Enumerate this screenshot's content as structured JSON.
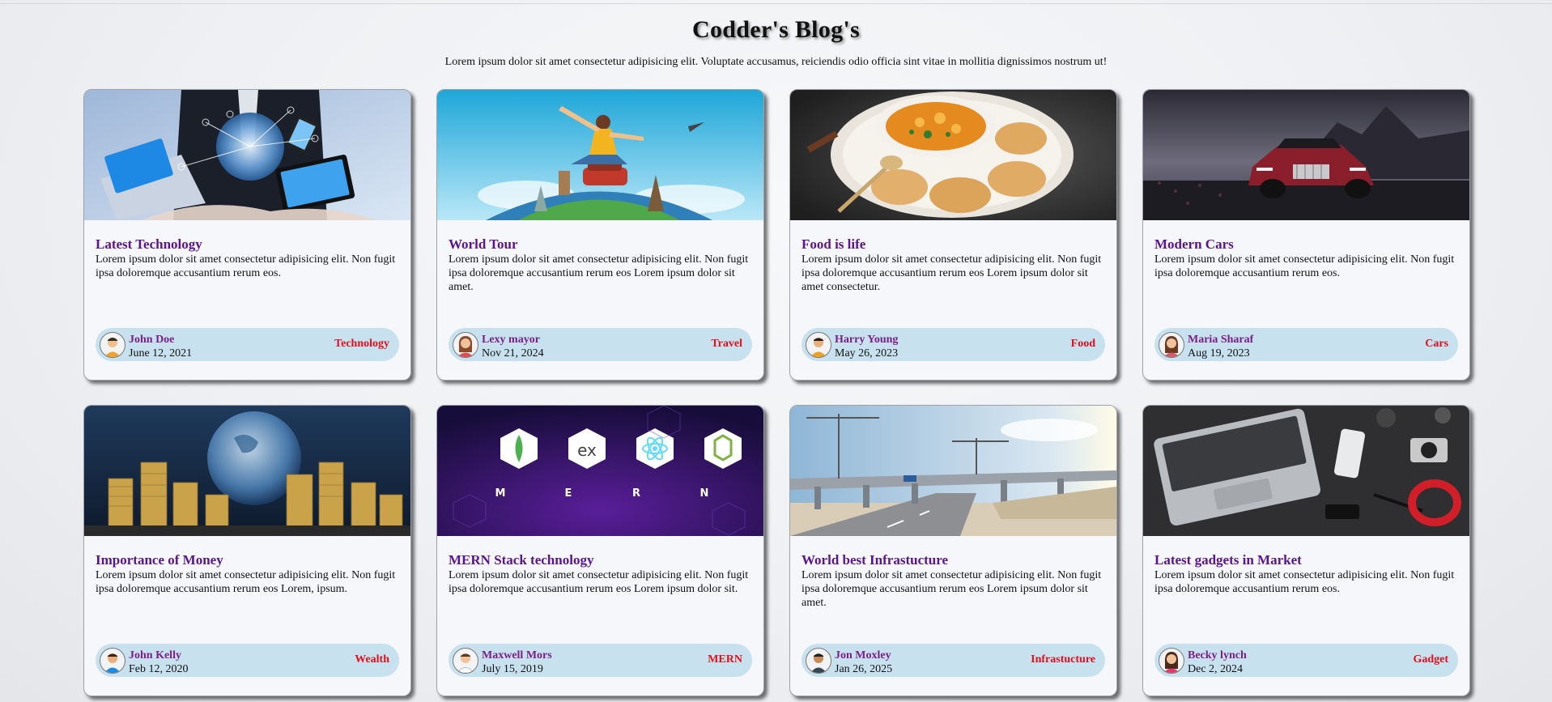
{
  "page": {
    "title": "Codder's Blog's",
    "subtitle": "Lorem ipsum dolor sit amet consectetur adipisicing elit. Voluptate accusamus, reiciendis odio officia sint vitae in mollitia dignissimos nostrum ut!"
  },
  "colors": {
    "title_color": "#5b1490",
    "author_color": "#7a1f8a",
    "category_color": "#e2101a",
    "meta_bg": "#c8e1ef"
  },
  "cards": [
    {
      "image": "technology-photo",
      "title": "Latest Technology",
      "body": "Lorem ipsum dolor sit amet consectetur adipisicing elit. Non fugit ipsa doloremque accusantium rerum eos.",
      "author": "John Doe",
      "date": "June 12, 2021",
      "category": "Technology"
    },
    {
      "image": "travel-photo",
      "title": "World Tour",
      "body": "Lorem ipsum dolor sit amet consectetur adipisicing elit. Non fugit ipsa doloremque accusantium rerum eos Lorem ipsum dolor sit amet.",
      "author": "Lexy mayor",
      "date": "Nov 21, 2024",
      "category": "Travel"
    },
    {
      "image": "food-photo",
      "title": "Food is life",
      "body": "Lorem ipsum dolor sit amet consectetur adipisicing elit. Non fugit ipsa doloremque accusantium rerum eos Lorem ipsum dolor sit amet consectetur.",
      "author": "Harry Young",
      "date": "May 26, 2023",
      "category": "Food"
    },
    {
      "image": "car-photo",
      "title": "Modern Cars",
      "body": "Lorem ipsum dolor sit amet consectetur adipisicing elit. Non fugit ipsa doloremque accusantium rerum eos.",
      "author": "Maria Sharaf",
      "date": "Aug 19, 2023",
      "category": "Cars"
    },
    {
      "image": "money-photo",
      "title": "Importance of Money",
      "body": "Lorem ipsum dolor sit amet consectetur adipisicing elit. Non fugit ipsa doloremque accusantium rerum eos Lorem, ipsum.",
      "author": "John Kelly",
      "date": "Feb 12, 2020",
      "category": "Wealth"
    },
    {
      "image": "mern-logo-banner",
      "title": "MERN Stack technology",
      "body": "Lorem ipsum dolor sit amet consectetur adipisicing elit. Non fugit ipsa doloremque accusantium rerum eos Lorem ipsum dolor sit.",
      "author": "Maxwell Mors",
      "date": "July 15, 2019",
      "category": "MERN",
      "banner": {
        "hex_labels": [
          "ex"
        ],
        "letters": [
          "M",
          "E",
          "R",
          "N"
        ]
      }
    },
    {
      "image": "infrastructure-photo",
      "title": "World best Infrastucture",
      "body": "Lorem ipsum dolor sit amet consectetur adipisicing elit. Non fugit ipsa doloremque accusantium rerum eos Lorem ipsum dolor sit amet.",
      "author": "Jon Moxley",
      "date": "Jan 26, 2025",
      "category": "Infrastucture"
    },
    {
      "image": "gadgets-photo",
      "title": "Latest gadgets in Market",
      "body": "Lorem ipsum dolor sit amet consectetur adipisicing elit. Non fugit ipsa doloremque accusantium rerum eos.",
      "author": "Becky lynch",
      "date": "Dec 2, 2024",
      "category": "Gadget"
    }
  ]
}
